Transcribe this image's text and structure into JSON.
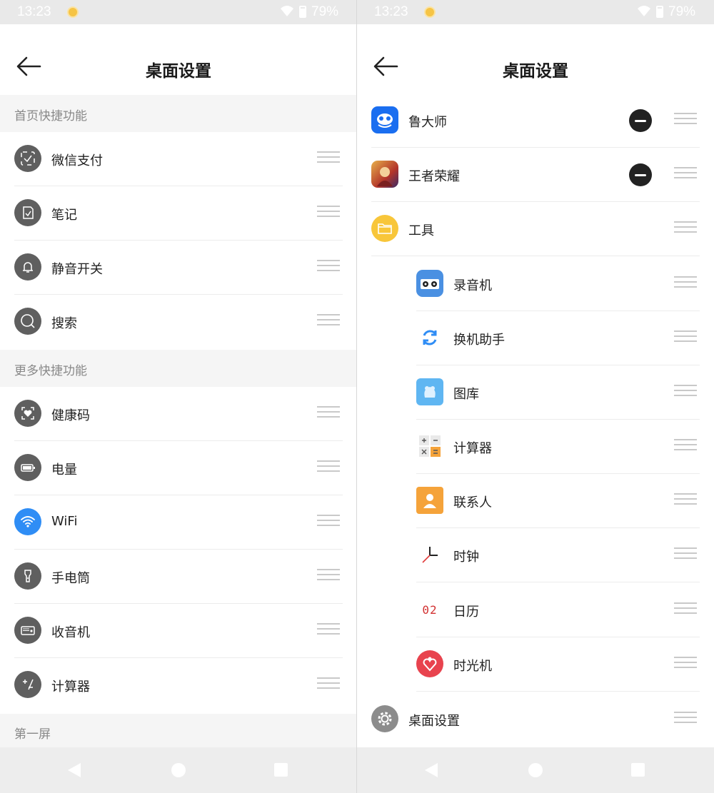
{
  "status_bar": {
    "time": "13:23",
    "battery": "79%"
  },
  "left_screen": {
    "title": "桌面设置",
    "sections": [
      {
        "label": "首页快捷功能"
      },
      {
        "label": "更多快捷功能"
      },
      {
        "label": "第一屏"
      }
    ],
    "home_items": [
      {
        "label": "微信支付",
        "icon": "wechat-pay-icon"
      },
      {
        "label": "笔记",
        "icon": "note-icon"
      },
      {
        "label": "静音开关",
        "icon": "bell-icon"
      },
      {
        "label": "搜索",
        "icon": "search-icon"
      }
    ],
    "more_items": [
      {
        "label": "健康码",
        "icon": "health-code-icon"
      },
      {
        "label": "电量",
        "icon": "battery-icon"
      },
      {
        "label": "WiFi",
        "icon": "wifi-icon",
        "color": "#2f8df5"
      },
      {
        "label": "手电筒",
        "icon": "flashlight-icon"
      },
      {
        "label": "收音机",
        "icon": "radio-icon"
      },
      {
        "label": "计算器",
        "icon": "calculator-icon"
      }
    ]
  },
  "right_screen": {
    "title": "桌面设置",
    "apps": [
      {
        "label": "鲁大师",
        "icon": "ludashi-icon",
        "removable": true
      },
      {
        "label": "王者荣耀",
        "icon": "honor-of-kings-icon",
        "removable": true
      },
      {
        "label": "工具",
        "icon": "folder-icon",
        "removable": false
      }
    ],
    "folder_items": [
      {
        "label": "录音机",
        "icon": "recorder-icon"
      },
      {
        "label": "换机助手",
        "icon": "phone-clone-icon"
      },
      {
        "label": "图库",
        "icon": "gallery-icon"
      },
      {
        "label": "计算器",
        "icon": "calculator-icon"
      },
      {
        "label": "联系人",
        "icon": "contacts-icon"
      },
      {
        "label": "时钟",
        "icon": "clock-icon"
      },
      {
        "label": "日历",
        "icon": "calendar-icon",
        "icon_text": "02"
      },
      {
        "label": "时光机",
        "icon": "time-machine-icon"
      }
    ],
    "bottom_item": {
      "label": "桌面设置",
      "icon": "settings-gear-icon"
    }
  },
  "colors": {
    "accent_blue": "#2f8df5",
    "icon_gray": "#5f5f5f",
    "section_bg": "#f5f5f5"
  }
}
